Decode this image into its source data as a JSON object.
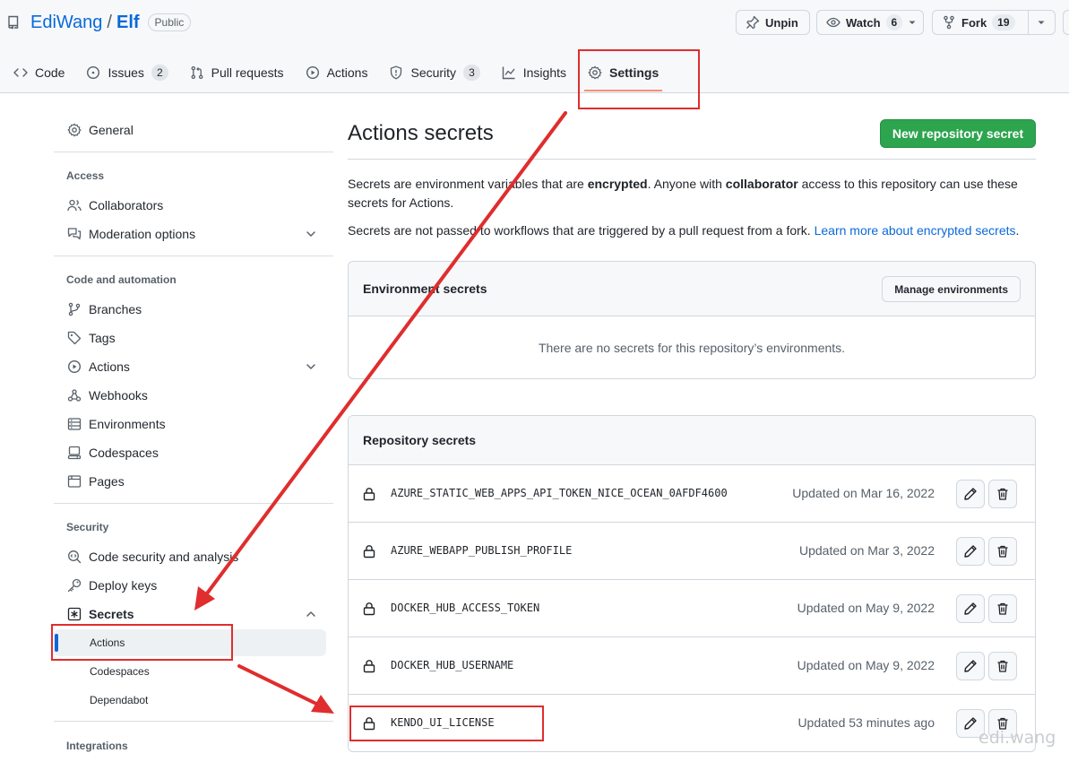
{
  "repo": {
    "owner": "EdiWang",
    "separator": "/",
    "name": "Elf",
    "visibility": "Public"
  },
  "header_actions": {
    "unpin": {
      "label": "Unpin"
    },
    "watch": {
      "label": "Watch",
      "count": "6"
    },
    "fork": {
      "label": "Fork",
      "count": "19"
    }
  },
  "tabs": [
    {
      "label": "Code",
      "icon": "code-icon"
    },
    {
      "label": "Issues",
      "count": "2",
      "icon": "issue-opened-icon"
    },
    {
      "label": "Pull requests",
      "icon": "git-pull-request-icon"
    },
    {
      "label": "Actions",
      "icon": "play-icon"
    },
    {
      "label": "Security",
      "count": "3",
      "icon": "shield-icon"
    },
    {
      "label": "Insights",
      "icon": "graph-icon"
    },
    {
      "label": "Settings",
      "icon": "gear-icon",
      "selected": true
    }
  ],
  "sidebar": {
    "general": "General",
    "access_heading": "Access",
    "collaborators": "Collaborators",
    "moderation": "Moderation options",
    "code_heading": "Code and automation",
    "branches": "Branches",
    "tags": "Tags",
    "actions": "Actions",
    "webhooks": "Webhooks",
    "environments": "Environments",
    "codespaces": "Codespaces",
    "pages": "Pages",
    "security_heading": "Security",
    "code_security": "Code security and analysis",
    "deploy_keys": "Deploy keys",
    "secrets": "Secrets",
    "secrets_sub": [
      "Actions",
      "Codespaces",
      "Dependabot"
    ],
    "integrations_heading": "Integrations"
  },
  "main": {
    "title": "Actions secrets",
    "new_button": "New repository secret",
    "desc1_a": "Secrets are environment variables that are ",
    "desc1_b": "encrypted",
    "desc1_c": ". Anyone with ",
    "desc1_d": "collaborator",
    "desc1_e": " access to this repository can use these secrets for Actions.",
    "desc2_a": "Secrets are not passed to workflows that are triggered by a pull request from a fork. ",
    "desc2_link": "Learn more about encrypted secrets",
    "desc2_end": ".",
    "env_heading": "Environment secrets",
    "manage_button": "Manage environments",
    "env_empty": "There are no secrets for this repository’s environments.",
    "repo_heading": "Repository secrets",
    "secrets": [
      {
        "name": "AZURE_STATIC_WEB_APPS_API_TOKEN_NICE_OCEAN_0AFDF4600",
        "updated": "Updated on Mar 16, 2022"
      },
      {
        "name": "AZURE_WEBAPP_PUBLISH_PROFILE",
        "updated": "Updated on Mar 3, 2022"
      },
      {
        "name": "DOCKER_HUB_ACCESS_TOKEN",
        "updated": "Updated on May 9, 2022"
      },
      {
        "name": "DOCKER_HUB_USERNAME",
        "updated": "Updated on May 9, 2022"
      },
      {
        "name": "KENDO_UI_LICENSE",
        "updated": "Updated 53 minutes ago"
      }
    ]
  },
  "watermark": "edi.wang",
  "colors": {
    "annotation": "#e02d2d",
    "primary_button": "#2da44e",
    "link": "#0969da",
    "tab_underline": "#fd8c73"
  }
}
